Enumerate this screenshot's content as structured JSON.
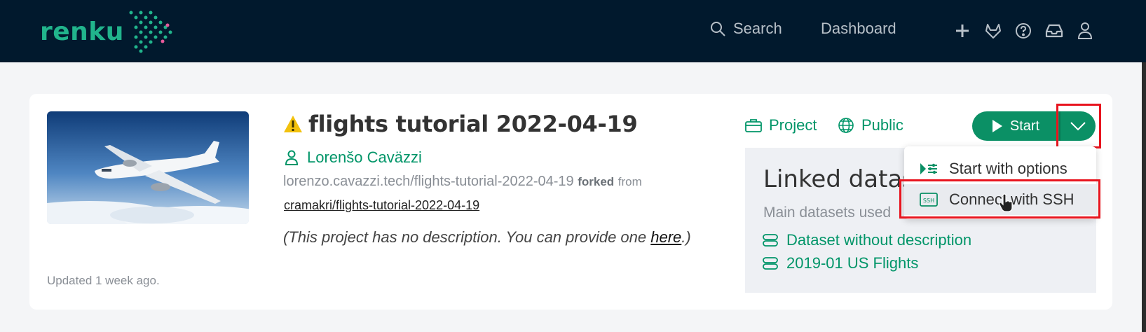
{
  "navbar": {
    "logo_text": "renku",
    "search_label": "Search",
    "dashboard_label": "Dashboard",
    "icons": [
      "plus-icon",
      "gitlab-icon",
      "help-icon",
      "inbox-icon",
      "user-icon"
    ]
  },
  "project": {
    "title": "flights tutorial 2022-04-19",
    "warning_icon": "warning-icon",
    "owner": "Lorenšo Caväzzi",
    "path": "lorenzo.cavazzi.tech/flights-tutorial-2022-04-19",
    "forked_label": "forked",
    "from_label": "from",
    "fork_source": "cramakri/flights-tutorial-2022-04-19",
    "description_prefix": "(This project has no description. You can provide one ",
    "description_link": "here",
    "description_suffix": ".)",
    "updated": "Updated 1 week ago.",
    "type_badge": "Project",
    "visibility_badge": "Public"
  },
  "actions": {
    "start_label": "Start"
  },
  "dropdown": {
    "items": [
      {
        "label": "Start with options",
        "icon": "options-icon"
      },
      {
        "label": "Connect with SSH",
        "icon": "ssh-icon"
      }
    ]
  },
  "datasets": {
    "title": "Linked datasets",
    "subtitle": "Main datasets used",
    "items": [
      "Dataset without description",
      "2019-01 US Flights"
    ]
  },
  "colors": {
    "navbar_bg": "#01192d",
    "accent": "#009568",
    "button": "#0b9065",
    "highlight": "#e8141e",
    "warning": "#f2c10d"
  }
}
